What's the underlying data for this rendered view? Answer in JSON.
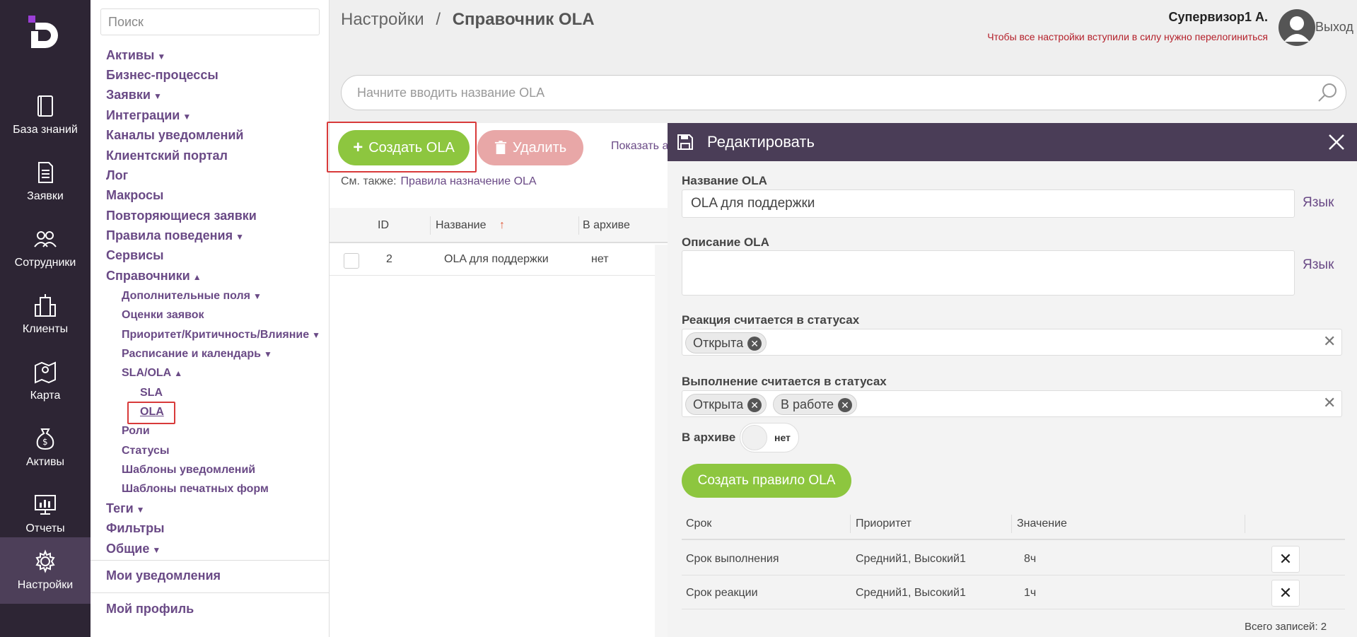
{
  "rail": {
    "items": [
      {
        "label": "База знаний",
        "icon": "book-icon"
      },
      {
        "label": "Заявки",
        "icon": "document-icon"
      },
      {
        "label": "Сотрудники",
        "icon": "people-icon"
      },
      {
        "label": "Клиенты",
        "icon": "building-icon"
      },
      {
        "label": "Карта",
        "icon": "map-icon"
      },
      {
        "label": "Активы",
        "icon": "money-bag-icon"
      },
      {
        "label": "Отчеты",
        "icon": "report-icon"
      },
      {
        "label": "Настройки",
        "icon": "gear-icon"
      }
    ]
  },
  "sidebar": {
    "search_placeholder": "Поиск",
    "items": [
      {
        "label": "Активы",
        "arrow": "▼"
      },
      {
        "label": "Бизнес-процессы",
        "arrow": ""
      },
      {
        "label": "Заявки",
        "arrow": "▼"
      },
      {
        "label": "Интеграции",
        "arrow": "▼"
      },
      {
        "label": "Каналы уведомлений",
        "arrow": ""
      },
      {
        "label": "Клиентский портал",
        "arrow": ""
      },
      {
        "label": "Лог",
        "arrow": ""
      },
      {
        "label": "Макросы",
        "arrow": ""
      },
      {
        "label": "Повторяющиеся заявки",
        "arrow": ""
      },
      {
        "label": "Правила поведения",
        "arrow": "▼"
      },
      {
        "label": "Сервисы",
        "arrow": ""
      },
      {
        "label": "Справочники",
        "arrow": "▲"
      },
      {
        "label": "Дополнительные поля",
        "arrow": "▼"
      },
      {
        "label": "Оценки заявок",
        "arrow": ""
      },
      {
        "label": "Приоритет/Критичность/Влияние",
        "arrow": "▼"
      },
      {
        "label": "Расписание и календарь",
        "arrow": "▼"
      },
      {
        "label": "SLA/OLA",
        "arrow": "▲"
      },
      {
        "label": "SLA",
        "arrow": ""
      },
      {
        "label": "OLA",
        "arrow": ""
      },
      {
        "label": "Роли",
        "arrow": ""
      },
      {
        "label": "Статусы",
        "arrow": ""
      },
      {
        "label": "Шаблоны уведомлений",
        "arrow": ""
      },
      {
        "label": "Шаблоны печатных форм",
        "arrow": ""
      },
      {
        "label": "Теги",
        "arrow": "▼"
      },
      {
        "label": "Фильтры",
        "arrow": ""
      },
      {
        "label": "Общие",
        "arrow": "▼"
      },
      {
        "label": "Мои уведомления",
        "arrow": ""
      },
      {
        "label": "Мой профиль",
        "arrow": ""
      }
    ]
  },
  "header": {
    "crumb_root": "Настройки",
    "crumb_sep": "/",
    "crumb_current": "Справочник OLA",
    "user_name": "Супервизор1 А.",
    "warning": "Чтобы все настройки вступили в силу нужно перелогиниться",
    "logout": "Выход"
  },
  "main": {
    "search_placeholder": "Начните вводить название OLA",
    "create_button": "Создать OLA",
    "delete_button": "Удалить",
    "show_link": "Показать а",
    "see_also_label": "См. также:",
    "see_also_link": "Правила назначение OLA",
    "columns": [
      "ID",
      "Название",
      "В архиве"
    ],
    "sort_indicator": "↑",
    "rows": [
      {
        "id": "2",
        "name": "OLA для поддержки",
        "archived": "нет"
      }
    ]
  },
  "panel": {
    "title": "Редактировать",
    "name_label": "Название OLA",
    "name_value": "OLA для поддержки",
    "lang": "Язык",
    "desc_label": "Описание OLA",
    "desc_value": "",
    "reaction_label": "Реакция считается в статусах",
    "reaction_tags": [
      "Открыта"
    ],
    "execution_label": "Выполнение считается в статусах",
    "execution_tags": [
      "Открыта",
      "В работе"
    ],
    "archive_label": "В архиве",
    "archive_value": "нет",
    "create_rule_button": "Создать правило OLA",
    "rule_columns": [
      "Срок",
      "Приоритет",
      "Значение"
    ],
    "rules": [
      {
        "term": "Срок выполнения",
        "priority": "Средний1, Высокий1",
        "value": "8ч"
      },
      {
        "term": "Срок реакции",
        "priority": "Средний1, Высокий1",
        "value": "1ч"
      }
    ],
    "total": "Всего записей: 2"
  },
  "colors": {
    "rail_bg": "#2d2534",
    "rail_active": "#4d3f59",
    "accent_purple": "#6a4a86",
    "green": "#8dc63f",
    "delete_pink": "#e8a7a7",
    "panel_header": "#4a3d57",
    "warning_red": "#b4212b",
    "highlight_red": "#d83a3a"
  }
}
